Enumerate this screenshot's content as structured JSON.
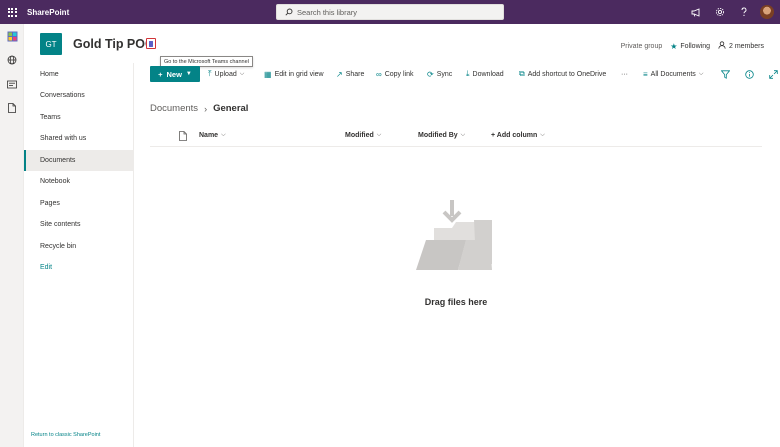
{
  "suitebar": {
    "brand": "SharePoint",
    "search_placeholder": "Search this library",
    "icons": [
      "waffle-icon",
      "search-icon",
      "megaphone-icon",
      "gear-icon",
      "help-icon",
      "avatar"
    ]
  },
  "appbar": {
    "icons": [
      "sharepoint-app-icon",
      "globe-icon",
      "news-icon",
      "document-icon"
    ]
  },
  "site": {
    "logo_initials": "GT",
    "title": "Gold Tip POC",
    "teams_tooltip": "Go to the Microsoft Teams channel",
    "privacy": "Private group",
    "follow_label": "Following",
    "members_label": "2 members"
  },
  "leftnav": {
    "items": [
      {
        "label": "Home"
      },
      {
        "label": "Conversations"
      },
      {
        "label": "Teams"
      },
      {
        "label": "Shared with us"
      },
      {
        "label": "Documents"
      },
      {
        "label": "Notebook"
      },
      {
        "label": "Pages"
      },
      {
        "label": "Site contents"
      },
      {
        "label": "Recycle bin"
      },
      {
        "label": "Edit"
      }
    ],
    "active": "Documents",
    "return_link": "Return to classic SharePoint"
  },
  "commandbar": {
    "new_label": "New",
    "upload_label": "Upload",
    "grid_label": "Edit in grid view",
    "share_label": "Share",
    "copy_link_label": "Copy link",
    "sync_label": "Sync",
    "download_label": "Download",
    "shortcut_label": "Add shortcut to OneDrive",
    "more_label": "···",
    "view_label": "All Documents"
  },
  "breadcrumb": {
    "root": "Documents",
    "current": "General"
  },
  "columns": {
    "name": "Name",
    "modified": "Modified",
    "modified_by": "Modified By",
    "add_column": "+ Add column"
  },
  "empty_state": {
    "text": "Drag files here"
  },
  "colors": {
    "suitebar": "#4b2a5f",
    "accent": "#038387",
    "text": "#323130"
  }
}
